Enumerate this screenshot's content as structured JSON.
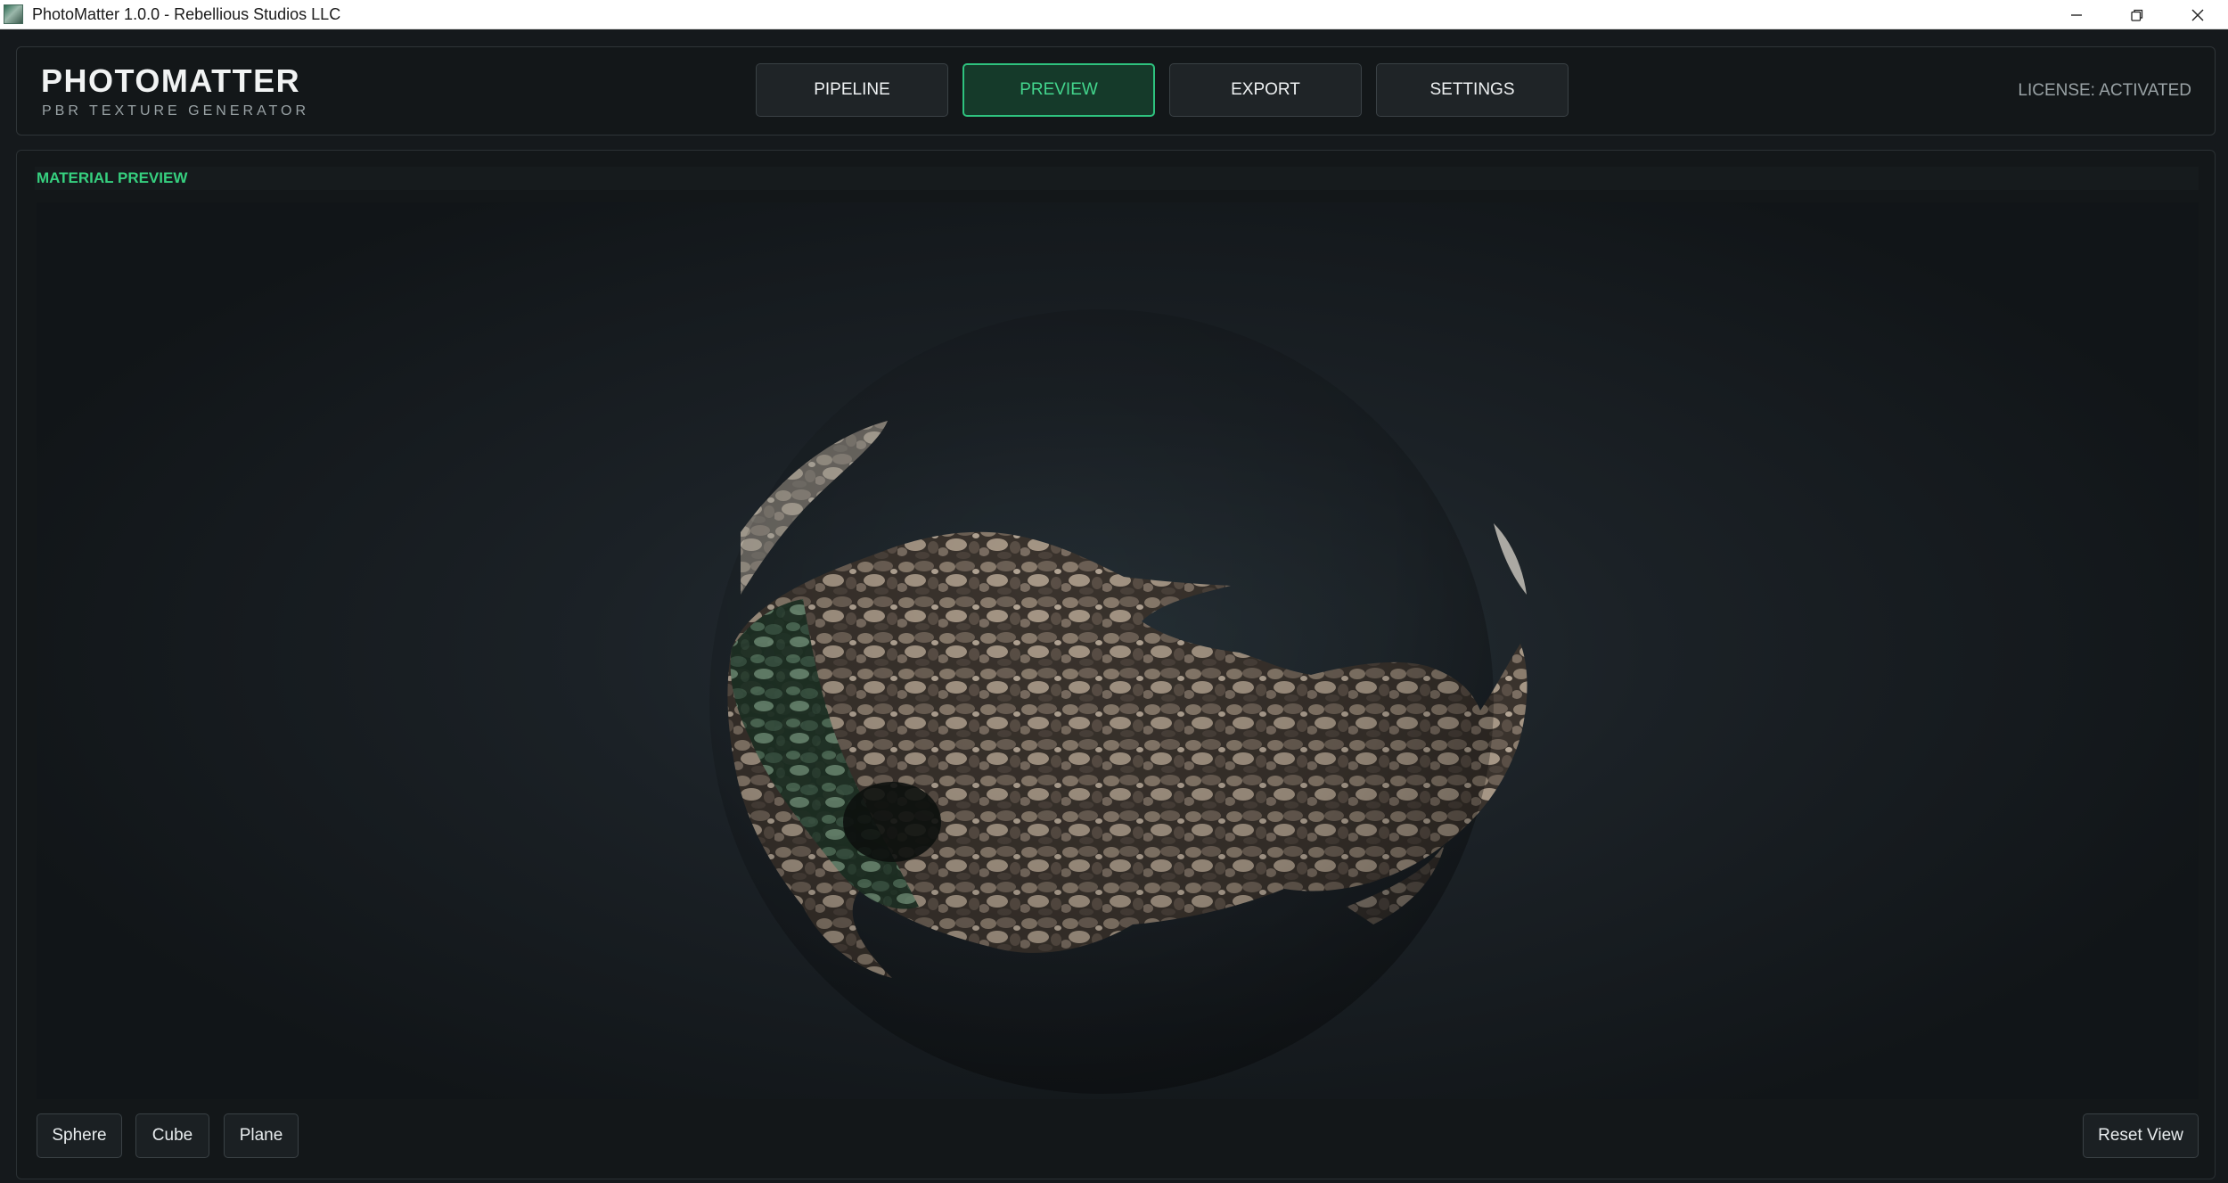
{
  "window": {
    "title": "PhotoMatter 1.0.0 - Rebellious Studios LLC",
    "controls": [
      "minimize-icon",
      "restore-icon",
      "close-icon"
    ]
  },
  "header": {
    "brand_title": "PHOTOMATTER",
    "brand_subtitle": "PBR TEXTURE GENERATOR",
    "nav": [
      {
        "label": "PIPELINE",
        "active": false
      },
      {
        "label": "PREVIEW",
        "active": true
      },
      {
        "label": "EXPORT",
        "active": false
      },
      {
        "label": "SETTINGS",
        "active": false
      }
    ],
    "license": "LICENSE: ACTIVATED"
  },
  "preview": {
    "title": "MATERIAL PREVIEW",
    "shape_buttons": [
      "Sphere",
      "Cube",
      "Plane"
    ],
    "reset_label": "Reset View",
    "active_shape": "Sphere"
  },
  "colors": {
    "accent": "#2ec27e",
    "accent_text": "#43d68d",
    "background": "#15191c",
    "panel": "#131719"
  }
}
